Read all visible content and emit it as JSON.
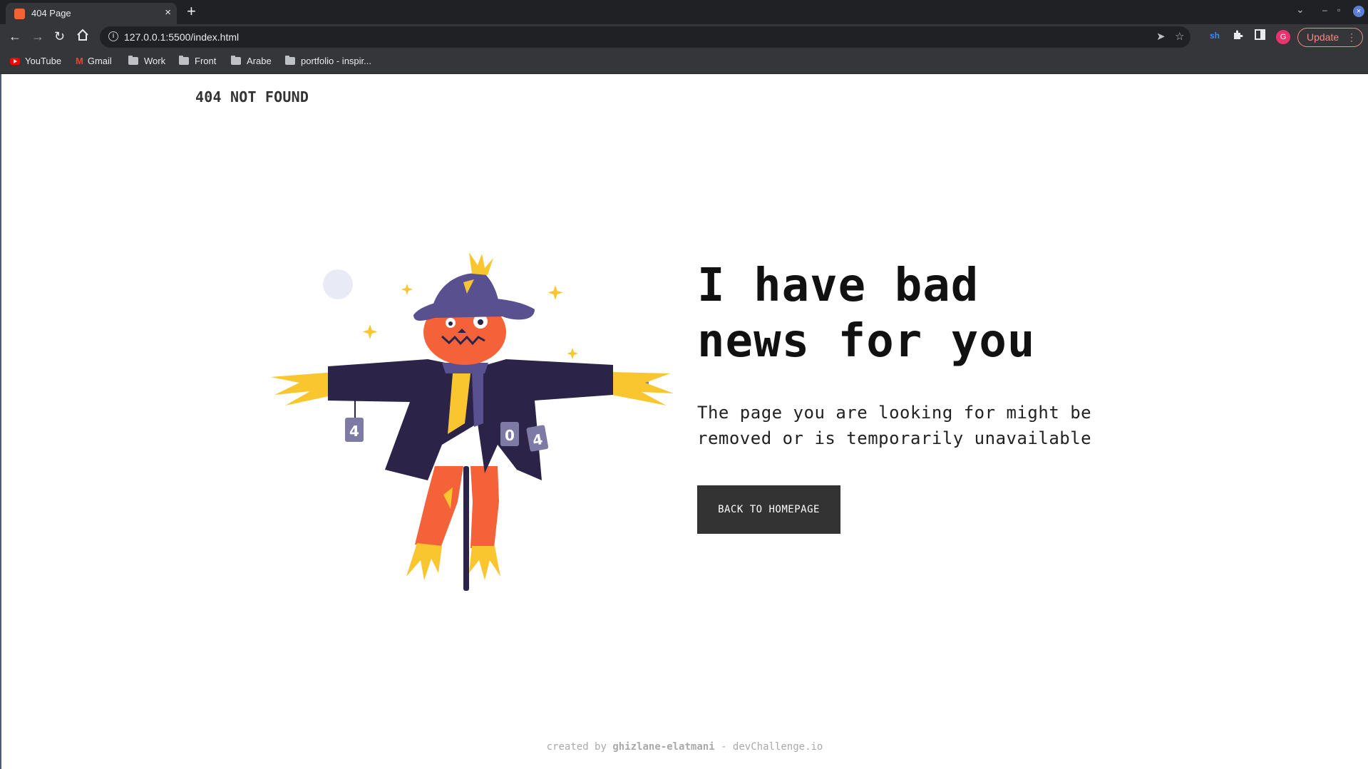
{
  "browser": {
    "tab_title": "404 Page",
    "tab_close": "×",
    "new_tab": "+",
    "url": "127.0.0.1:5500/index.html",
    "update_label": "Update",
    "profile_initial": "G",
    "icons": [
      "back-arrow-icon",
      "forward-arrow-icon",
      "reload-icon",
      "home-icon",
      "info-icon",
      "send-icon",
      "star-icon",
      "extension-sh-icon",
      "puzzle-icon",
      "side-panel-icon"
    ]
  },
  "bookmarks": [
    {
      "label": "YouTube",
      "icon": "youtube-icon"
    },
    {
      "label": "Gmail",
      "icon": "gmail-icon"
    },
    {
      "label": "Work",
      "icon": "folder-icon"
    },
    {
      "label": "Front",
      "icon": "folder-icon"
    },
    {
      "label": "Arabe",
      "icon": "folder-icon"
    },
    {
      "label": "portfolio - inspir...",
      "icon": "folder-icon"
    }
  ],
  "page": {
    "logo": "404 NOT FOUND",
    "headline_line1": "I have bad",
    "headline_line2": "news for you",
    "subtext": "The page you are looking for might be removed or is temporarily unavailable",
    "cta": "BACK TO HOMEPAGE",
    "footer_prefix": "created by ",
    "footer_author": "ghizlane-elatmani",
    "footer_suffix": " - devChallenge.io",
    "cans": [
      "4",
      "0",
      "4"
    ]
  },
  "colors": {
    "accent_dark": "#333333",
    "hat": "#58508f",
    "coat": "#2b2348",
    "face": "#f4623a",
    "straw": "#f9c630",
    "moon": "#e8ebf5"
  }
}
